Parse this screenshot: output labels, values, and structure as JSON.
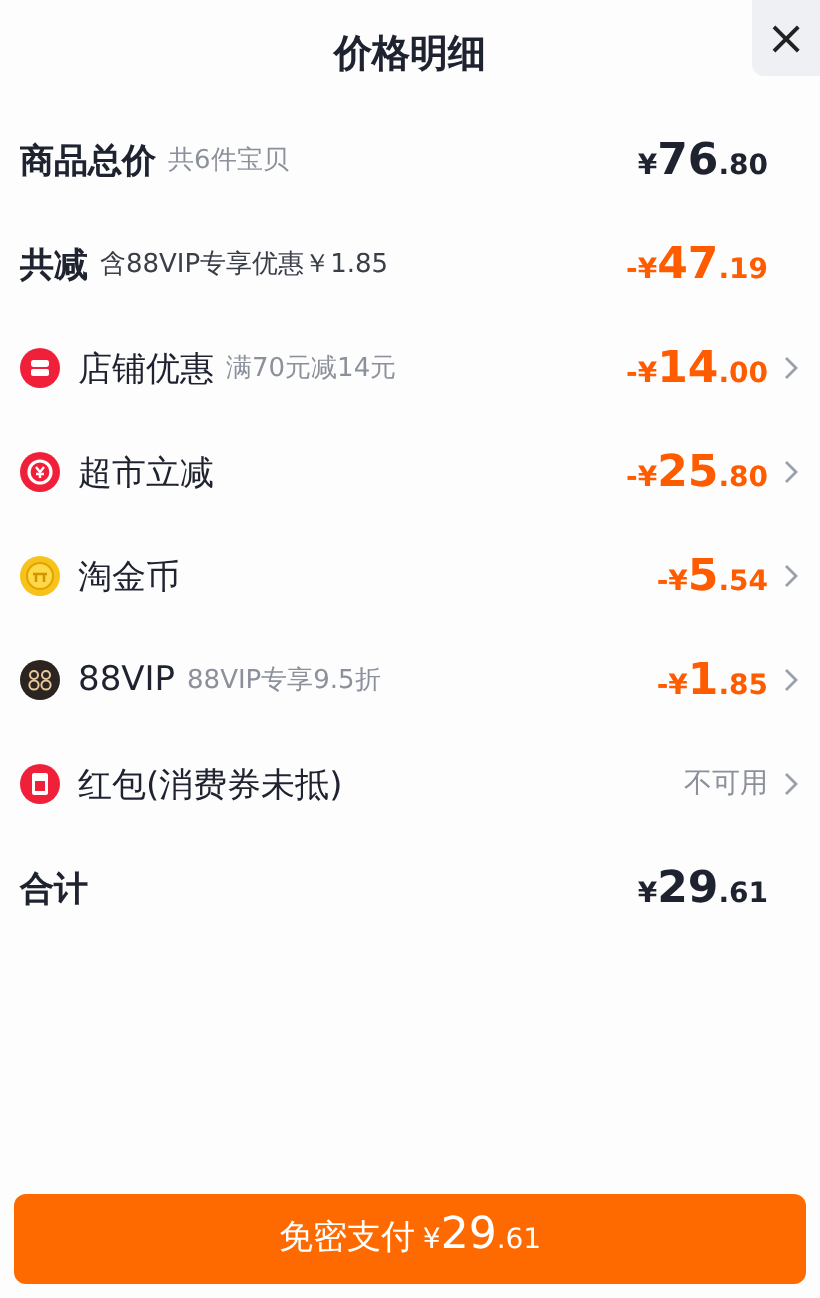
{
  "header": {
    "title": "价格明细",
    "close": "×"
  },
  "summary": [
    {
      "kind": "plain",
      "label": "商品总价",
      "note": "共6件宝贝",
      "price": {
        "currency": "¥",
        "integer": "76",
        "decimal": ".80"
      }
    },
    {
      "kind": "discount",
      "label": "共减",
      "note": "含88VIP专享优惠￥1.85",
      "price": {
        "sign": "-",
        "currency": "¥",
        "integer": "47",
        "decimal": ".19"
      }
    }
  ],
  "items": [
    {
      "kind": "discount",
      "label": "店铺优惠",
      "note": "满70元减14元",
      "price": {
        "sign": "-",
        "currency": "¥",
        "integer": "14",
        "decimal": ".00"
      }
    },
    {
      "kind": "discount",
      "label": "超市立减",
      "price": {
        "sign": "-",
        "currency": "¥",
        "integer": "25",
        "decimal": ".80"
      }
    },
    {
      "kind": "discount",
      "label": "淘金币",
      "price": {
        "sign": "-",
        "currency": "¥",
        "integer": "5",
        "decimal": ".54"
      }
    },
    {
      "kind": "discount",
      "label": "88VIP",
      "note": "88VIP专享9.5折",
      "price": {
        "sign": "-",
        "currency": "¥",
        "integer": "1",
        "decimal": ".85"
      }
    },
    {
      "kind": "status",
      "label": "红包(消费券未抵)",
      "status": "不可用"
    }
  ],
  "total": {
    "label": "合计",
    "price": {
      "currency": "¥",
      "integer": "29",
      "decimal": ".61"
    }
  },
  "pay_button": {
    "label": "免密支付",
    "price": {
      "currency": "¥",
      "integer": "29",
      "decimal": ".61"
    }
  }
}
